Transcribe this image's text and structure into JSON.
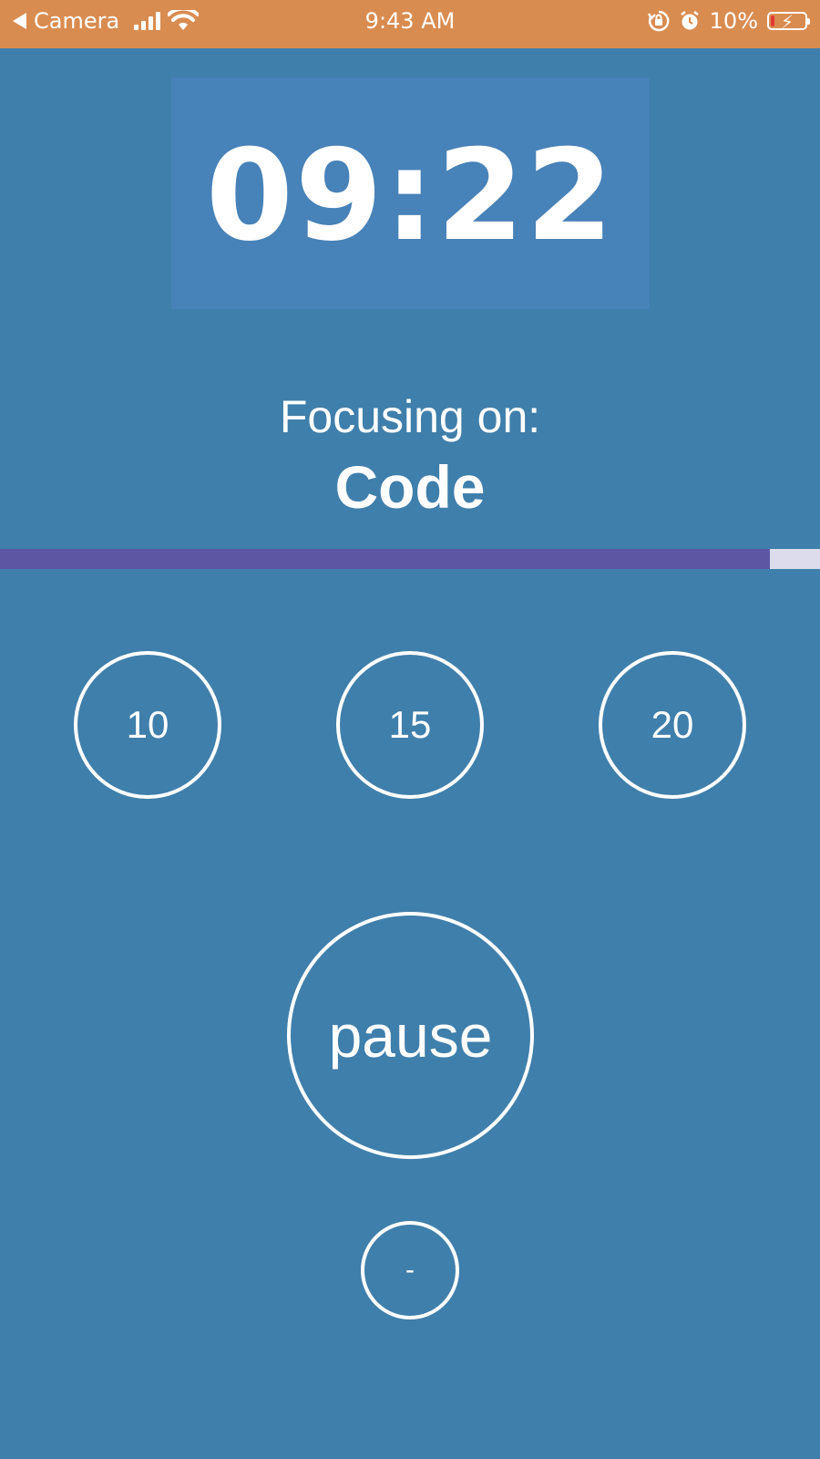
{
  "status_bar": {
    "back_label": "Camera",
    "time": "9:43 AM",
    "battery_percent": "10%",
    "background_color": "#d98c50",
    "icons": [
      "back-arrow-icon",
      "cellular-signal-icon",
      "wifi-icon",
      "orientation-lock-icon",
      "alarm-icon",
      "battery-charging-icon"
    ]
  },
  "timer": {
    "display": "09:22"
  },
  "focus": {
    "label": "Focusing on:",
    "task": "Code"
  },
  "progress": {
    "fraction": 0.939,
    "fill_color": "#5c56a3",
    "track_color": "#dcdcec"
  },
  "presets": [
    {
      "label": "10"
    },
    {
      "label": "15"
    },
    {
      "label": "20"
    }
  ],
  "controls": {
    "pause_label": "pause",
    "minus_label": "-"
  },
  "colors": {
    "background": "#3f7fab",
    "timer_box": "#4782b8"
  }
}
